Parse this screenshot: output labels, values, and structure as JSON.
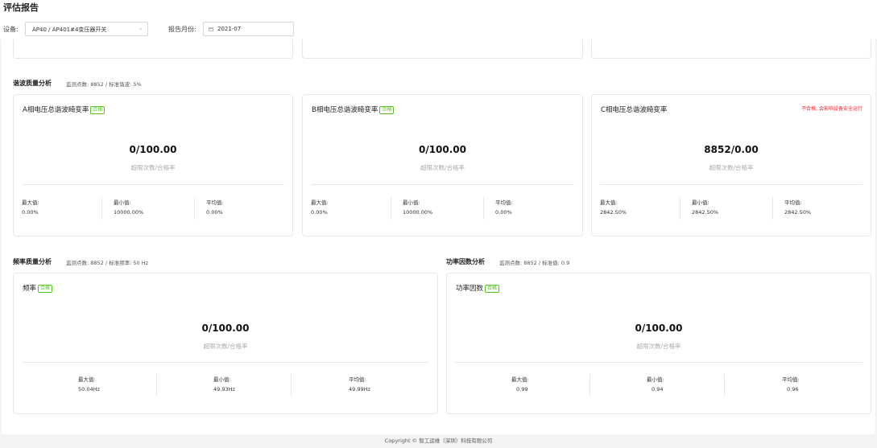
{
  "header": {
    "title": "评估报告",
    "device_label": "设备:",
    "device_value": "AP40 / AP401#4变压器开关",
    "month_label": "报告月份:",
    "month_value": "2021-07"
  },
  "harmonic": {
    "title": "谐波质量分析",
    "meta": "监测点数: 8852 / 标准谐波: 5%",
    "cards": [
      {
        "title": "A相电压总谐波畸变率",
        "badge": "合格",
        "warning": "",
        "value": "0/100.00",
        "value_label": "超限次数/合格率",
        "stats": [
          {
            "label": "最大值:",
            "value": "0.00%"
          },
          {
            "label": "最小值:",
            "value": "10000.00%"
          },
          {
            "label": "平均值:",
            "value": "0.00%"
          }
        ]
      },
      {
        "title": "B相电压总谐波畸变率",
        "badge": "合格",
        "warning": "",
        "value": "0/100.00",
        "value_label": "超限次数/合格率",
        "stats": [
          {
            "label": "最大值:",
            "value": "0.00%"
          },
          {
            "label": "最小值:",
            "value": "10000.00%"
          },
          {
            "label": "平均值:",
            "value": "0.00%"
          }
        ]
      },
      {
        "title": "C相电压总谐波畸变率",
        "badge": "",
        "warning": "不合格, 会影响设备安全运行",
        "value": "8852/0.00",
        "value_label": "超限次数/合格率",
        "stats": [
          {
            "label": "最大值:",
            "value": "2842.50%"
          },
          {
            "label": "最小值:",
            "value": "2842.50%"
          },
          {
            "label": "平均值:",
            "value": "2842.50%"
          }
        ]
      }
    ]
  },
  "frequency": {
    "title": "频率质量分析",
    "meta": "监测点数: 8852 / 标准频率: 50 Hz",
    "card": {
      "title": "频率",
      "badge": "合格",
      "value": "0/100.00",
      "value_label": "超限次数/合格率",
      "stats": [
        {
          "label": "最大值:",
          "value": "50.04Hz"
        },
        {
          "label": "最小值:",
          "value": "49.93Hz"
        },
        {
          "label": "平均值:",
          "value": "49.99Hz"
        }
      ]
    }
  },
  "power_factor": {
    "title": "功率因数分析",
    "meta": "监测点数: 8852 / 标准值: 0.9",
    "card": {
      "title": "功率因数",
      "badge": "合格",
      "value": "0/100.00",
      "value_label": "超限次数/合格率",
      "stats": [
        {
          "label": "最大值:",
          "value": "0.99"
        },
        {
          "label": "最小值:",
          "value": "0.94"
        },
        {
          "label": "平均值:",
          "value": "0.96"
        }
      ]
    }
  },
  "footer": {
    "copyright": "Copyright © 智工运维（深圳）科技有限公司"
  }
}
